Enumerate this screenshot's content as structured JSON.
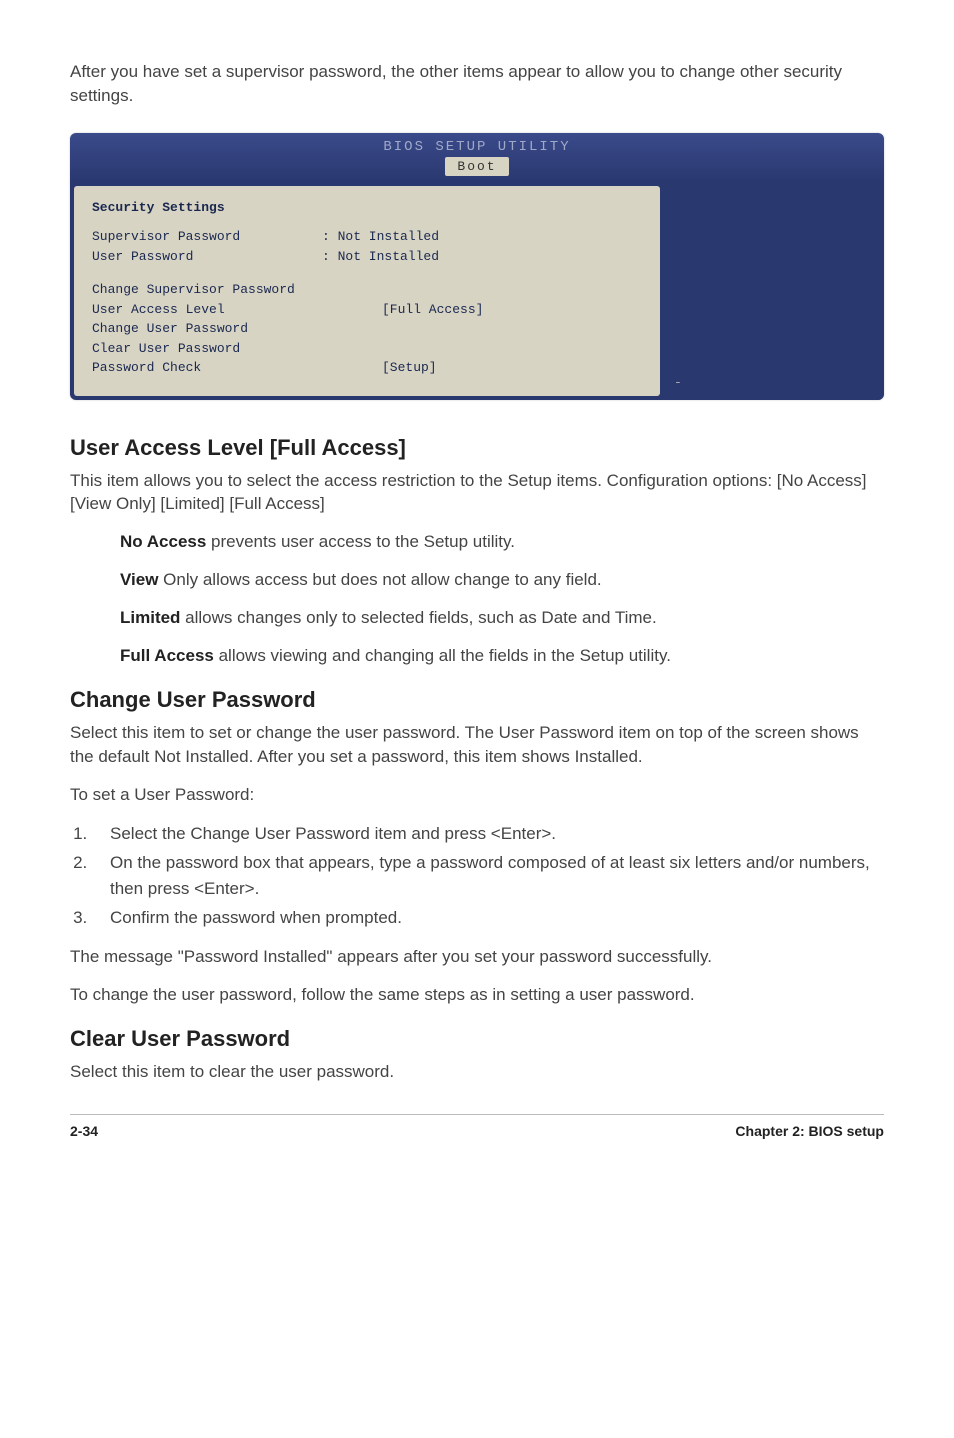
{
  "intro": "After you have set a supervisor password, the other items appear to allow you to change other security settings.",
  "bios": {
    "headerTitle": "BIOS SETUP UTILITY",
    "tab": "Boot",
    "sectionHeading": "Security Settings",
    "rows": {
      "supervisorPasswordLabel": "Supervisor Password",
      "supervisorPasswordValue": ": Not Installed",
      "userPasswordLabel": "User Password",
      "userPasswordValue": ": Not Installed",
      "changeSupervisor": "Change Supervisor Password",
      "userAccessLabel": "User Access Level",
      "userAccessValue": "[Full Access]",
      "changeUser": "Change User Password",
      "clearUser": "Clear User Password",
      "passwordCheckLabel": "Password Check",
      "passwordCheckValue": "[Setup]"
    },
    "rightMarker": "-"
  },
  "sections": {
    "userAccess": {
      "title": "User Access Level [Full Access]",
      "desc": "This item allows you to select the access restriction to the Setup items. Configuration options: [No Access] [View Only] [Limited] [Full Access]",
      "noAccessLabel": "No Access",
      "noAccessText": " prevents user access to the Setup utility.",
      "viewLabel": "View",
      "viewText": " Only allows access but does not allow change to any field.",
      "limitedLabel": "Limited",
      "limitedText": " allows changes only to selected fields, such as Date and Time.",
      "fullLabel": "Full Access",
      "fullText": " allows viewing and changing all the fields in the Setup utility."
    },
    "changeUser": {
      "title": "Change User Password",
      "p1": "Select this item to set or change the user password. The User Password item on top of the screen shows the default Not Installed. After you set a password, this item shows Installed.",
      "p2": "To set a User Password:",
      "li1": "Select the Change User Password item and press <Enter>.",
      "li2": "On the password box that appears, type a password composed of at least six letters and/or numbers, then press <Enter>.",
      "li3": "Confirm the password when prompted.",
      "p3": "The message \"Password Installed\" appears after you set your password successfully.",
      "p4": "To change the user password, follow the same steps as in setting a user password."
    },
    "clearUser": {
      "title": "Clear User Password",
      "p1": "Select this item to clear the user password."
    }
  },
  "footer": {
    "left": "2-34",
    "right": "Chapter 2: BIOS setup"
  }
}
